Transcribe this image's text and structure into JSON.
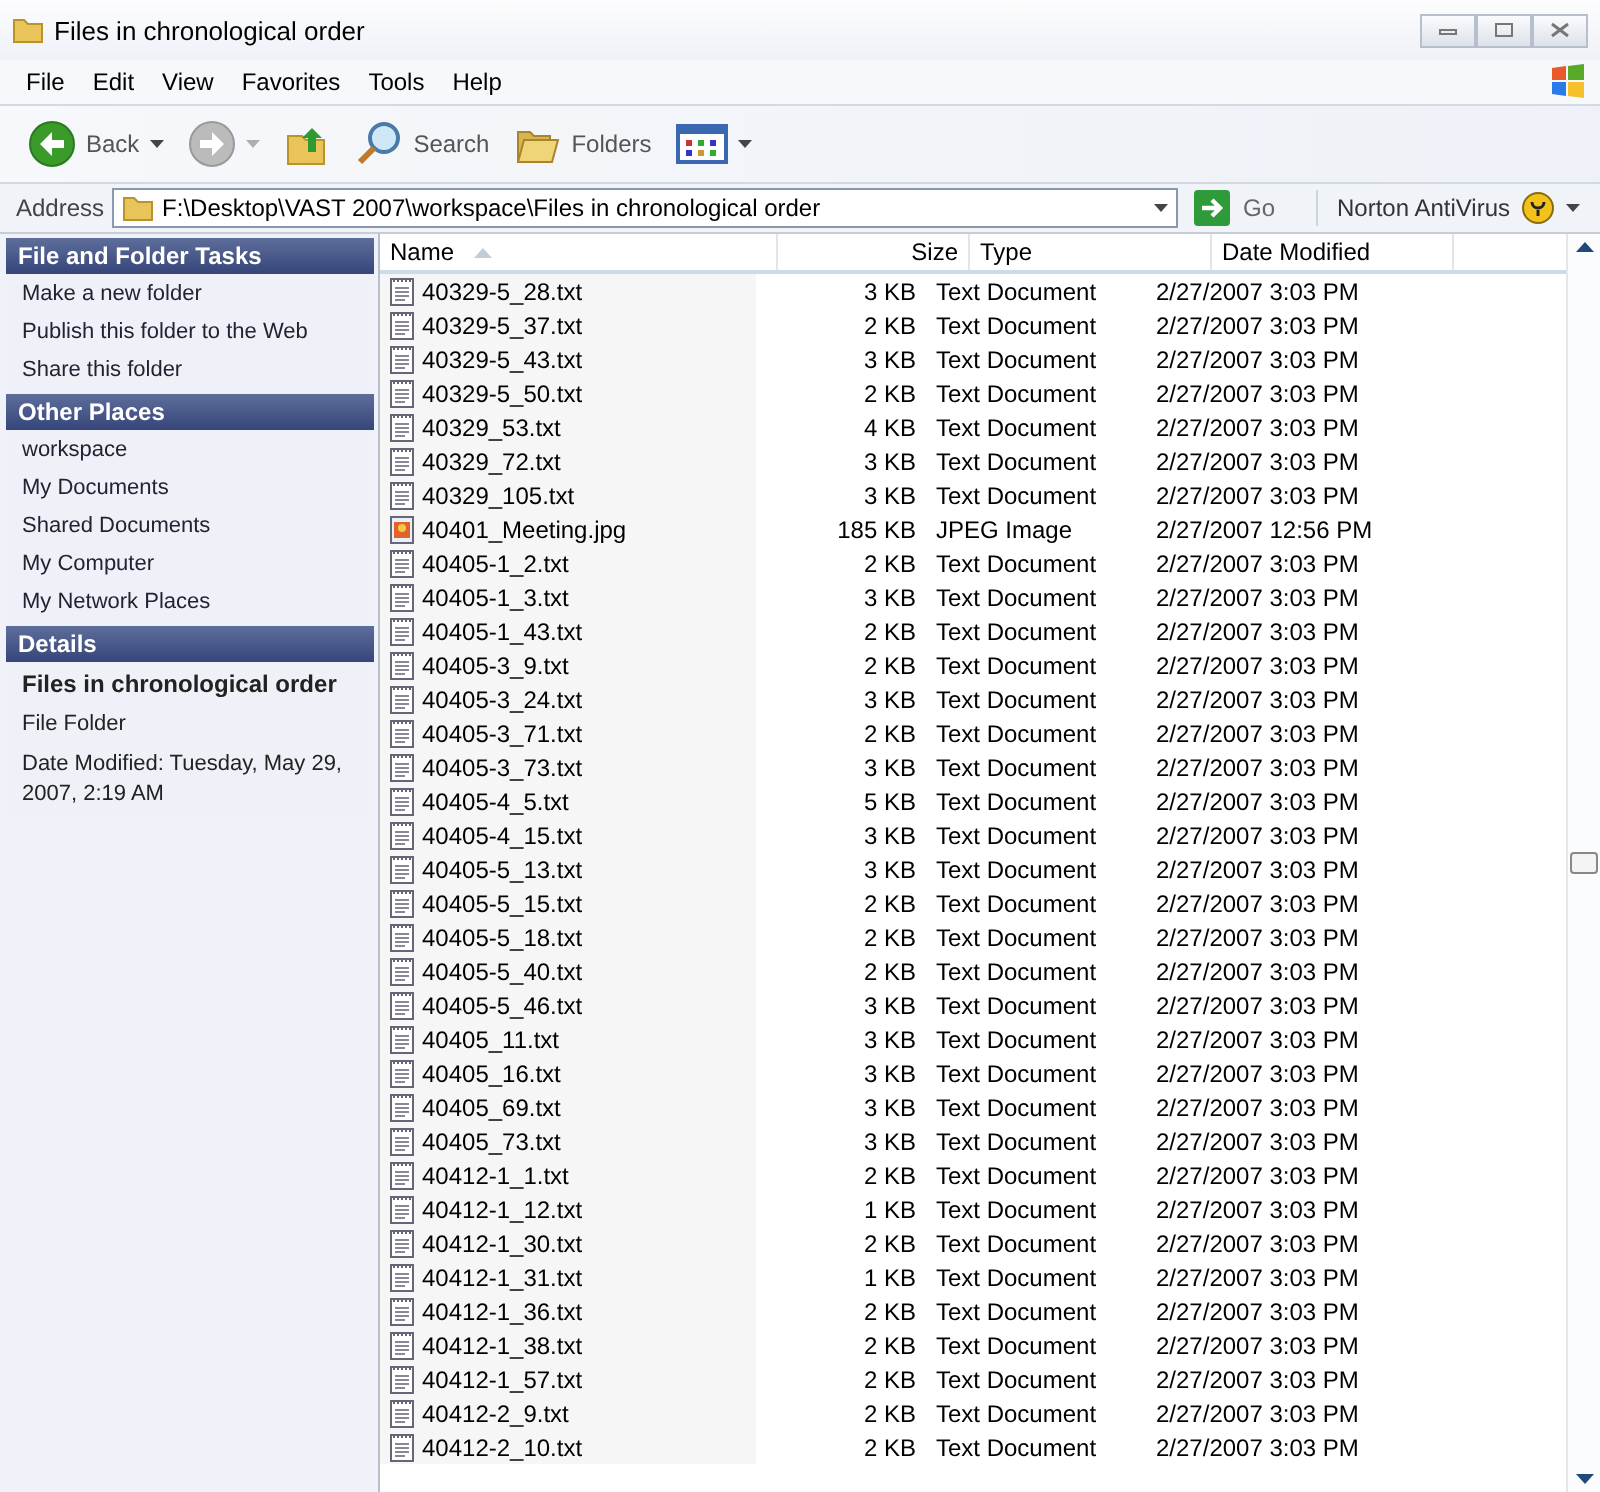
{
  "window": {
    "title": "Files in chronological order"
  },
  "menu": [
    "File",
    "Edit",
    "View",
    "Favorites",
    "Tools",
    "Help"
  ],
  "toolbar": [
    {
      "kind": "back",
      "label": "Back",
      "disabled": false
    },
    {
      "kind": "forward",
      "disabled": true
    },
    {
      "kind": "up"
    },
    {
      "kind": "search",
      "label": "Search"
    },
    {
      "kind": "folders",
      "label": "Folders"
    },
    {
      "kind": "views"
    }
  ],
  "address": {
    "label": "Address",
    "value": "F:\\Desktop\\VAST 2007\\workspace\\Files in chronological order",
    "go": "Go",
    "norton": "Norton AntiVirus"
  },
  "sidebar": {
    "sections": [
      {
        "title": "File and Folder Tasks",
        "items": [
          "Make a new folder",
          "Publish this folder to the Web",
          "Share this folder"
        ]
      },
      {
        "title": "Other Places",
        "items": [
          "workspace",
          "My Documents",
          "Shared Documents",
          "My Computer",
          "My Network Places"
        ]
      }
    ],
    "details": {
      "title": "Details",
      "name": "Files in chronological order",
      "type": "File Folder",
      "modified": "Date Modified: Tuesday, May 29, 2007, 2:19 AM"
    }
  },
  "table": {
    "columns": [
      {
        "label": "Name",
        "sorted": true
      },
      {
        "label": "Size",
        "sorted": false
      },
      {
        "label": "Type",
        "sorted": false
      },
      {
        "label": "Date Modified",
        "sorted": false
      }
    ],
    "rows": [
      {
        "kind": "text",
        "name": "40329-5_28.txt",
        "size": "3 KB",
        "type": "Text Document",
        "date": "2/27/2007 3:03 PM"
      },
      {
        "kind": "text",
        "name": "40329-5_37.txt",
        "size": "2 KB",
        "type": "Text Document",
        "date": "2/27/2007 3:03 PM"
      },
      {
        "kind": "text",
        "name": "40329-5_43.txt",
        "size": "3 KB",
        "type": "Text Document",
        "date": "2/27/2007 3:03 PM"
      },
      {
        "kind": "text",
        "name": "40329-5_50.txt",
        "size": "2 KB",
        "type": "Text Document",
        "date": "2/27/2007 3:03 PM"
      },
      {
        "kind": "text",
        "name": "40329_53.txt",
        "size": "4 KB",
        "type": "Text Document",
        "date": "2/27/2007 3:03 PM"
      },
      {
        "kind": "text",
        "name": "40329_72.txt",
        "size": "3 KB",
        "type": "Text Document",
        "date": "2/27/2007 3:03 PM"
      },
      {
        "kind": "text",
        "name": "40329_105.txt",
        "size": "3 KB",
        "type": "Text Document",
        "date": "2/27/2007 3:03 PM"
      },
      {
        "kind": "image",
        "name": "40401_Meeting.jpg",
        "size": "185 KB",
        "type": "JPEG Image",
        "date": "2/27/2007 12:56 PM"
      },
      {
        "kind": "text",
        "name": "40405-1_2.txt",
        "size": "2 KB",
        "type": "Text Document",
        "date": "2/27/2007 3:03 PM"
      },
      {
        "kind": "text",
        "name": "40405-1_3.txt",
        "size": "3 KB",
        "type": "Text Document",
        "date": "2/27/2007 3:03 PM"
      },
      {
        "kind": "text",
        "name": "40405-1_43.txt",
        "size": "2 KB",
        "type": "Text Document",
        "date": "2/27/2007 3:03 PM"
      },
      {
        "kind": "text",
        "name": "40405-3_9.txt",
        "size": "2 KB",
        "type": "Text Document",
        "date": "2/27/2007 3:03 PM"
      },
      {
        "kind": "text",
        "name": "40405-3_24.txt",
        "size": "3 KB",
        "type": "Text Document",
        "date": "2/27/2007 3:03 PM"
      },
      {
        "kind": "text",
        "name": "40405-3_71.txt",
        "size": "2 KB",
        "type": "Text Document",
        "date": "2/27/2007 3:03 PM"
      },
      {
        "kind": "text",
        "name": "40405-3_73.txt",
        "size": "3 KB",
        "type": "Text Document",
        "date": "2/27/2007 3:03 PM"
      },
      {
        "kind": "text",
        "name": "40405-4_5.txt",
        "size": "5 KB",
        "type": "Text Document",
        "date": "2/27/2007 3:03 PM"
      },
      {
        "kind": "text",
        "name": "40405-4_15.txt",
        "size": "3 KB",
        "type": "Text Document",
        "date": "2/27/2007 3:03 PM"
      },
      {
        "kind": "text",
        "name": "40405-5_13.txt",
        "size": "3 KB",
        "type": "Text Document",
        "date": "2/27/2007 3:03 PM"
      },
      {
        "kind": "text",
        "name": "40405-5_15.txt",
        "size": "2 KB",
        "type": "Text Document",
        "date": "2/27/2007 3:03 PM"
      },
      {
        "kind": "text",
        "name": "40405-5_18.txt",
        "size": "2 KB",
        "type": "Text Document",
        "date": "2/27/2007 3:03 PM"
      },
      {
        "kind": "text",
        "name": "40405-5_40.txt",
        "size": "2 KB",
        "type": "Text Document",
        "date": "2/27/2007 3:03 PM"
      },
      {
        "kind": "text",
        "name": "40405-5_46.txt",
        "size": "3 KB",
        "type": "Text Document",
        "date": "2/27/2007 3:03 PM"
      },
      {
        "kind": "text",
        "name": "40405_11.txt",
        "size": "3 KB",
        "type": "Text Document",
        "date": "2/27/2007 3:03 PM"
      },
      {
        "kind": "text",
        "name": "40405_16.txt",
        "size": "3 KB",
        "type": "Text Document",
        "date": "2/27/2007 3:03 PM"
      },
      {
        "kind": "text",
        "name": "40405_69.txt",
        "size": "3 KB",
        "type": "Text Document",
        "date": "2/27/2007 3:03 PM"
      },
      {
        "kind": "text",
        "name": "40405_73.txt",
        "size": "3 KB",
        "type": "Text Document",
        "date": "2/27/2007 3:03 PM"
      },
      {
        "kind": "text",
        "name": "40412-1_1.txt",
        "size": "2 KB",
        "type": "Text Document",
        "date": "2/27/2007 3:03 PM"
      },
      {
        "kind": "text",
        "name": "40412-1_12.txt",
        "size": "1 KB",
        "type": "Text Document",
        "date": "2/27/2007 3:03 PM"
      },
      {
        "kind": "text",
        "name": "40412-1_30.txt",
        "size": "2 KB",
        "type": "Text Document",
        "date": "2/27/2007 3:03 PM"
      },
      {
        "kind": "text",
        "name": "40412-1_31.txt",
        "size": "1 KB",
        "type": "Text Document",
        "date": "2/27/2007 3:03 PM"
      },
      {
        "kind": "text",
        "name": "40412-1_36.txt",
        "size": "2 KB",
        "type": "Text Document",
        "date": "2/27/2007 3:03 PM"
      },
      {
        "kind": "text",
        "name": "40412-1_38.txt",
        "size": "2 KB",
        "type": "Text Document",
        "date": "2/27/2007 3:03 PM"
      },
      {
        "kind": "text",
        "name": "40412-1_57.txt",
        "size": "2 KB",
        "type": "Text Document",
        "date": "2/27/2007 3:03 PM"
      },
      {
        "kind": "text",
        "name": "40412-2_9.txt",
        "size": "2 KB",
        "type": "Text Document",
        "date": "2/27/2007 3:03 PM"
      },
      {
        "kind": "text",
        "name": "40412-2_10.txt",
        "size": "2 KB",
        "type": "Text Document",
        "date": "2/27/2007 3:03 PM"
      }
    ]
  }
}
